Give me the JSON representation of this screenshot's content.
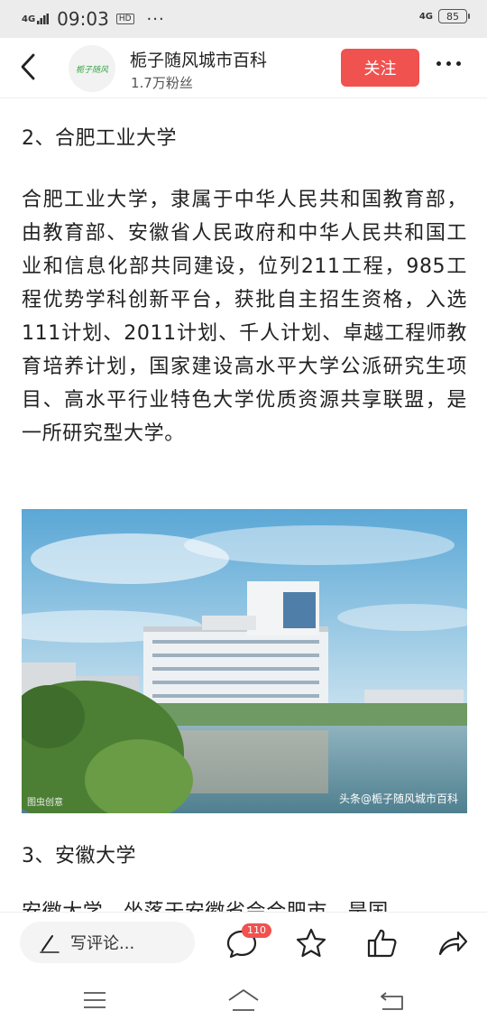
{
  "status_bar": {
    "network_left": "4G",
    "network_hd": "HD",
    "time": "09:03",
    "hd_badge": "HD",
    "more": "···",
    "network_right": "4G",
    "battery": "85"
  },
  "header": {
    "avatar_text": "栀子随风",
    "account_name": "栀子随风城市百科",
    "followers": "1.7万粉丝",
    "follow_label": "关注"
  },
  "article": {
    "heading1": "2、合肥工业大学",
    "paragraph1": "合肥工业大学，隶属于中华人民共和国教育部，由教育部、安徽省人民政府和中华人民共和国工业和信息化部共同建设，位列211工程，985工程优势学科创新平台，获批自主招生资格，入选111计划、2011计划、千人计划、卓越工程师教育培养计划，国家建设高水平大学公派研究生项目、高水平行业特色大学优质资源共享联盟，是一所研究型大学。",
    "image_caption_left": "图虫创意",
    "image_caption_right": "头条@栀子随风城市百科",
    "heading2": "3、安徽大学",
    "paragraph2_partial": "安徽大学，坐落于安徽省会合肥市，是国"
  },
  "bottom_bar": {
    "comment_placeholder": "写评论...",
    "comment_count": "110"
  },
  "icons": [
    "back-icon",
    "pencil-icon",
    "comment-icon",
    "star-icon",
    "thumbs-up-icon",
    "share-icon",
    "menu-icon",
    "home-icon",
    "return-icon"
  ],
  "colors": {
    "accent": "#f0524f",
    "status_bar": "#ececec"
  }
}
